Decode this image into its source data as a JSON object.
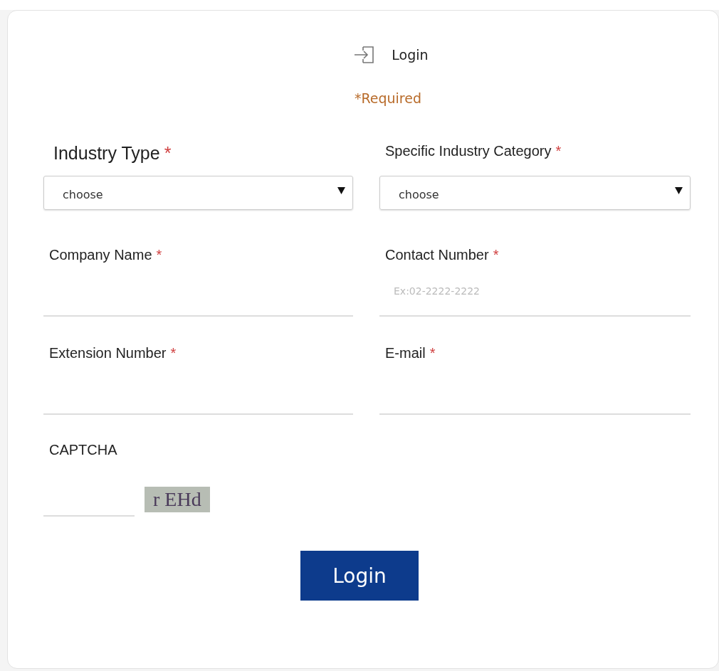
{
  "header": {
    "title": "Login"
  },
  "required_note": "*Required",
  "fields": [
    {
      "kind": "select",
      "label": "Industry Type",
      "marker": "*",
      "value": "choose",
      "large": true
    },
    {
      "kind": "select",
      "label": "Specific Industry Category",
      "marker": "*",
      "value": "choose",
      "large": false
    },
    {
      "kind": "text",
      "label": "Company Name",
      "marker": "*"
    },
    {
      "kind": "text",
      "label": "Contact Number",
      "marker": "*",
      "placeholder": "Ex:02-2222-2222"
    },
    {
      "kind": "text",
      "label": "Extension Number",
      "marker": "*"
    },
    {
      "kind": "text",
      "label": "E-mail",
      "marker": "*"
    }
  ],
  "captcha": {
    "label": "CAPTCHA",
    "code": "r EHd"
  },
  "submit": "Login"
}
